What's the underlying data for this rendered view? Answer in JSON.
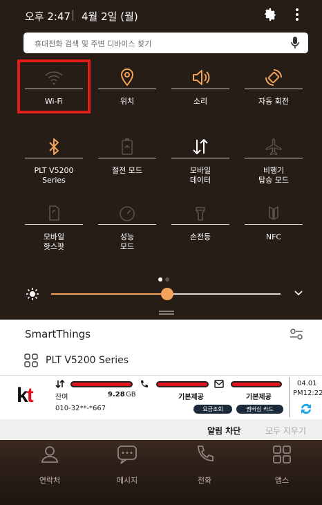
{
  "status_bar": {
    "time": "오후 2:47",
    "separator": "|",
    "date": "4월 2일 (월)"
  },
  "search": {
    "placeholder": "휴대전화 검색 및 주변 디바이스 찾기"
  },
  "quick_tiles": [
    {
      "label": "Wi-Fi",
      "icon": "wifi-icon"
    },
    {
      "label": "위치",
      "icon": "location-icon"
    },
    {
      "label": "소리",
      "icon": "sound-icon"
    },
    {
      "label": "자동 회전",
      "icon": "auto-rotate-icon"
    },
    {
      "label": "PLT V5200\nSeries",
      "icon": "bluetooth-icon"
    },
    {
      "label": "절전 모드",
      "icon": "power-saving-icon"
    },
    {
      "label": "모바일\n데이터",
      "icon": "mobile-data-icon"
    },
    {
      "label": "비행기\n탑승 모드",
      "icon": "airplane-icon"
    },
    {
      "label": "모바일\n핫스팟",
      "icon": "hotspot-icon"
    },
    {
      "label": "성능\n모드",
      "icon": "performance-icon"
    },
    {
      "label": "손전등",
      "icon": "flashlight-icon"
    },
    {
      "label": "NFC",
      "icon": "nfc-icon"
    }
  ],
  "brightness": {
    "level": 0.5
  },
  "colors": {
    "accent": "#f3a35a",
    "panel_bg": "#261d17",
    "highlight": "#e41c1c",
    "kt_red": "#e2141d"
  },
  "smartthings": {
    "title": "SmartThings",
    "device": "PLT V5200 Series"
  },
  "kt_widget": {
    "logo_k": "k",
    "logo_t": "t",
    "remain_label": "잔여",
    "data_amount": "9.28",
    "data_unit": "GB",
    "call_label": "기본제공",
    "msg_label": "기본제공",
    "phone": "010-32**-*667",
    "btn_fee": "요금조회",
    "btn_membership": "멤버십 카드",
    "date": "04.01",
    "time": "PM12:22"
  },
  "notification_actions": {
    "block": "알림 차단",
    "clear_all": "모두 지우기"
  },
  "dock": [
    {
      "label": "연락처",
      "icon": "contacts-icon"
    },
    {
      "label": "메시지",
      "icon": "messages-icon"
    },
    {
      "label": "전화",
      "icon": "phone-icon"
    },
    {
      "label": "앱스",
      "icon": "apps-icon"
    }
  ]
}
